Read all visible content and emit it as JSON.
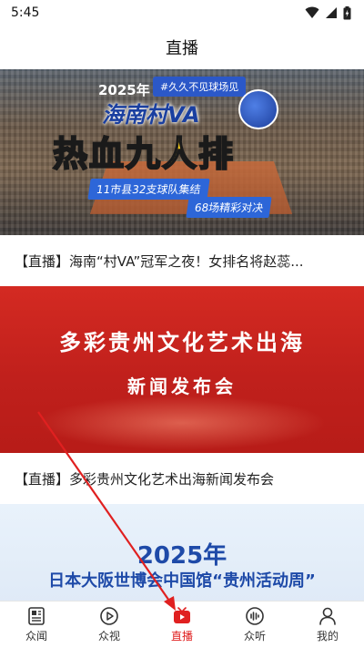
{
  "status_bar": {
    "time": "5:45"
  },
  "header": {
    "title": "直播"
  },
  "feed": [
    {
      "caption": "【直播】海南“村VA”冠军之夜！女排名将赵蕊...",
      "banner": {
        "year": "2025年",
        "hashtag": "#久久不见球场见",
        "place": "海南村VA",
        "headline": "热血九人排",
        "tag_a": "11市县32支球队集结",
        "tag_b": "68场精彩对决"
      }
    },
    {
      "caption": "【直播】多彩贵州文化艺术出海新闻发布会",
      "banner": {
        "line1": "多彩贵州文化艺术出海",
        "line2": "新闻发布会"
      }
    },
    {
      "banner": {
        "year": "2025年",
        "title": "日本大阪世博会中国馆“贵州活动周”"
      }
    }
  ],
  "bottom_nav": [
    {
      "label": "众闻",
      "icon": "newspaper-icon",
      "active": false
    },
    {
      "label": "众视",
      "icon": "play-circle-icon",
      "active": false
    },
    {
      "label": "直播",
      "icon": "tv-icon",
      "active": true
    },
    {
      "label": "众听",
      "icon": "audio-wave-icon",
      "active": false
    },
    {
      "label": "我的",
      "icon": "person-icon",
      "active": false
    }
  ],
  "colors": {
    "accent": "#e02020",
    "banner_red": "#c0201c",
    "expo_blue": "#1e4aa8"
  }
}
